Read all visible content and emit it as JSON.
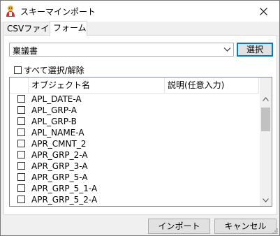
{
  "window": {
    "title": "スキーマインポート"
  },
  "tabs": [
    {
      "label": "CSVファイル"
    },
    {
      "label": "フォーム"
    }
  ],
  "form_selector": {
    "value": "稟議書",
    "select_label": "選択"
  },
  "select_all_label": "すべて選択/解除",
  "grid": {
    "columns": [
      "オブジェクト名",
      "説明(任意入力)"
    ],
    "rows": [
      "APL_DATE-A",
      "APL_GRP-A",
      "APL_GRP-B",
      "APL_NAME-A",
      "APR_CMNT_2",
      "APR_GRP_2-A",
      "APR_GRP_3-A",
      "APR_GRP_5-A",
      "APR_GRP_5_1-A",
      "APR_GRP_5_2-A"
    ]
  },
  "footer": {
    "import_label": "インポート",
    "cancel_label": "キャンセル"
  },
  "colors": {
    "accent": "#0078d7",
    "panel": "#f0f0f0"
  }
}
